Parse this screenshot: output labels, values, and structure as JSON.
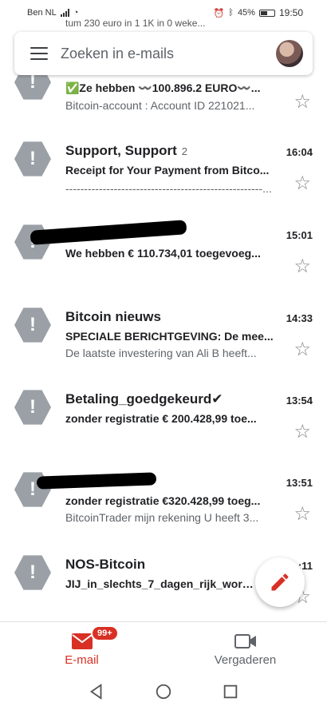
{
  "status_bar": {
    "carrier": "Ben NL",
    "battery": "45%",
    "time": "19:50"
  },
  "peek_row_text": "tum 230 euro in 1 1K in 0 weke...",
  "search": {
    "placeholder": "Zoeken in e-mails"
  },
  "emails": [
    {
      "sender": "",
      "sender_count": "",
      "date": "",
      "subject": "✅Ze hebben 〰️100.896.2 EURO〰️...",
      "snippet": "Bitcoin-account : Account ID 221021..."
    },
    {
      "sender": "Support, Support",
      "sender_count": "2",
      "date": "16:04",
      "subject": "Receipt for Your Payment from Bitco...",
      "snippet": "-----------------------------------------------------..."
    },
    {
      "sender": "",
      "sender_count": "",
      "date": "15:01",
      "subject": "We hebben € 110.734,01 toegevoeg...",
      "snippet": ""
    },
    {
      "sender": "Bitcoin nieuws",
      "sender_count": "",
      "date": "14:33",
      "subject": "SPECIALE BERICHTGEVING: De mee...",
      "snippet": "De laatste investering van Ali B heeft..."
    },
    {
      "sender": "Betaling_goedgekeurd✔",
      "sender_count": "",
      "date": "13:54",
      "subject": "zonder registratie  € 200.428,99 toe...",
      "snippet": ""
    },
    {
      "sender": "",
      "sender_count": "",
      "date": "13:51",
      "subject": "zonder registratie  €320.428,99 toeg...",
      "snippet": "BitcoinTrader mijn rekening U heeft 3..."
    },
    {
      "sender": "NOS-Bitcoin",
      "sender_count": "",
      "date": "…:11",
      "subject": "JIJ_in_slechts_7_dagen_rijk_worden",
      "snippet": ""
    }
  ],
  "alert_glyph": "!",
  "star_glyph": "☆",
  "bottom_nav": {
    "mail_label": "E-mail",
    "mail_badge": "99+",
    "meet_label": "Vergaderen"
  },
  "colors": {
    "accent_red": "#d93025",
    "alert_grey": "#9aa0a6"
  },
  "icons": [
    "hamburger-icon",
    "alert-icon",
    "star-icon",
    "pencil-icon",
    "mail-icon",
    "video-camera-icon",
    "back-icon",
    "home-icon",
    "recents-icon"
  ]
}
